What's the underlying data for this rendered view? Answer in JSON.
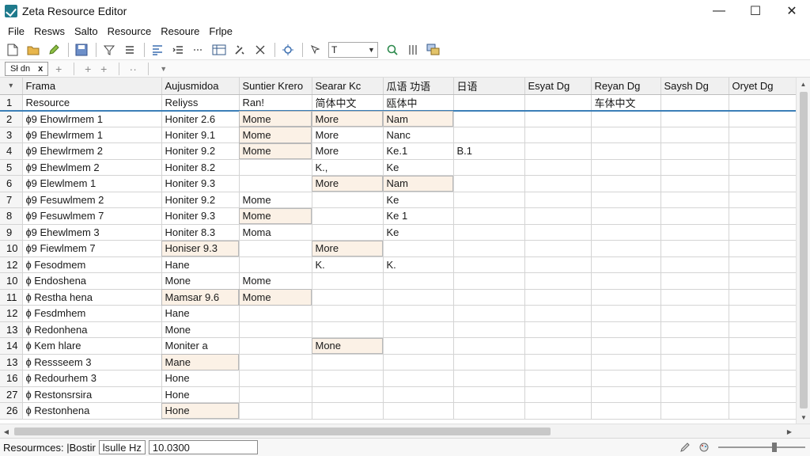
{
  "window": {
    "title": "Zeta Resource Editor",
    "minimize": "—",
    "maximize": "☐",
    "close": "✕"
  },
  "menu": [
    "File",
    "Resws",
    "Salto",
    "Resource",
    "Resoure",
    "Frlpe"
  ],
  "toolbar": {
    "combo_value": "T"
  },
  "tabrow": {
    "chip_label": "Sł dn",
    "chip_close": "x"
  },
  "grid": {
    "corner": "▾",
    "columns": [
      "Frama",
      "Aujusmidoa",
      "Suntier Krero",
      "Searar Kc",
      "瓜语 功语",
      "日语",
      "Esyat Dg",
      "Reyan Dg",
      "Saysh Dg",
      "Oryet Dg"
    ],
    "rows": [
      {
        "num": "1",
        "cells": [
          "Resource",
          "Reliyss",
          "Ran!",
          "简体中文",
          "瓯体中",
          "",
          "",
          "车体中文",
          "",
          ""
        ],
        "hl": []
      },
      {
        "num": "2",
        "cells": [
          "ɸ9 Ehowlrmem 1",
          "Honiter 2.6",
          "Mome",
          "More",
          "Nam",
          "",
          "",
          "",
          "",
          ""
        ],
        "hl": [
          2,
          3,
          4
        ]
      },
      {
        "num": "3",
        "cells": [
          "ɸ9 Ehewlrmem 1",
          "Honiter 9.1",
          "Mome",
          "More",
          "Nanc",
          "",
          "",
          "",
          "",
          ""
        ],
        "hl": [
          2
        ]
      },
      {
        "num": "4",
        "cells": [
          "ɸ9 Ehewlrmem 2",
          "Honiter 9.2",
          "Mome",
          "More",
          "Ke.1",
          "B.1",
          "",
          "",
          "",
          ""
        ],
        "hl": [
          2
        ]
      },
      {
        "num": "5",
        "cells": [
          "ɸ9 Ehewlmem 2",
          "Honiter 8.2",
          "",
          "K.,",
          "Ke",
          "",
          "",
          "",
          "",
          ""
        ],
        "hl": []
      },
      {
        "num": "6",
        "cells": [
          "ɸ9 Elewlmem 1",
          "Honiter 9.3",
          "",
          "More",
          "Nam",
          "",
          "",
          "",
          "",
          ""
        ],
        "hl": [
          3,
          4
        ]
      },
      {
        "num": "7",
        "cells": [
          "ɸ9 Fesuwlmem 2",
          "Honiter 9.2",
          "Mome",
          "",
          "Ke",
          "",
          "",
          "",
          "",
          ""
        ],
        "hl": []
      },
      {
        "num": "8",
        "cells": [
          "ɸ9 Fesuwlmem 7",
          "Honiter 9.3",
          "Mome",
          "",
          "Ke 1",
          "",
          "",
          "",
          "",
          ""
        ],
        "hl": [
          2
        ]
      },
      {
        "num": "9",
        "cells": [
          "ɸ9 Ehewlmem 3",
          "Honiter 8.3",
          "Moma",
          "",
          "Ke",
          "",
          "",
          "",
          "",
          ""
        ],
        "hl": []
      },
      {
        "num": "10",
        "cells": [
          "ɸ9 Fiewlmem 7",
          "Honiser 9.3",
          "",
          "More",
          "",
          "",
          "",
          "",
          "",
          ""
        ],
        "hl": [
          1,
          3
        ]
      },
      {
        "num": "12",
        "cells": [
          "ɸ Fesodmem",
          "Hane",
          "",
          "K.",
          "K.",
          "",
          "",
          "",
          "",
          ""
        ],
        "hl": []
      },
      {
        "num": "10",
        "cells": [
          "ɸ Endoshena",
          "Mone",
          "Mome",
          "",
          "",
          "",
          "",
          "",
          "",
          ""
        ],
        "hl": []
      },
      {
        "num": "11",
        "cells": [
          "ɸ Restha hena",
          "Mamsar 9.6",
          "Mome",
          "",
          "",
          "",
          "",
          "",
          "",
          ""
        ],
        "hl": [
          1,
          2
        ]
      },
      {
        "num": "12",
        "cells": [
          "ɸ Fesdmhem",
          "Hane",
          "",
          "",
          "",
          "",
          "",
          "",
          "",
          ""
        ],
        "hl": []
      },
      {
        "num": "13",
        "cells": [
          "ɸ Redonhena",
          "Mone",
          "",
          "",
          "",
          "",
          "",
          "",
          "",
          ""
        ],
        "hl": []
      },
      {
        "num": "14",
        "cells": [
          "ɸ Kem hlare",
          "Moniter a",
          "",
          "Mone",
          "",
          "",
          "",
          "",
          "",
          ""
        ],
        "hl": [
          3
        ]
      },
      {
        "num": "13",
        "cells": [
          "ɸ Ressseem 3",
          "Mane",
          "",
          "",
          "",
          "",
          "",
          "",
          "",
          ""
        ],
        "hl": [
          1
        ]
      },
      {
        "num": "16",
        "cells": [
          "ɸ Redourhem 3",
          "Hone",
          "",
          "",
          "",
          "",
          "",
          "",
          "",
          ""
        ],
        "hl": []
      },
      {
        "num": "27",
        "cells": [
          "ɸ Restonsrsira",
          "Hone",
          "",
          "",
          "",
          "",
          "",
          "",
          "",
          ""
        ],
        "hl": []
      },
      {
        "num": "26",
        "cells": [
          "ɸ Restonhena",
          "Hone",
          "",
          "",
          "",
          "",
          "",
          "",
          "",
          ""
        ],
        "hl": [
          1
        ]
      }
    ]
  },
  "status": {
    "label": "Resourmces: |Bostir",
    "field1": "lsulle Hz",
    "field2": "10.0300"
  },
  "colors": {
    "highlight_cell": "#fbf1e6",
    "selection_line": "#3b7fb7"
  }
}
